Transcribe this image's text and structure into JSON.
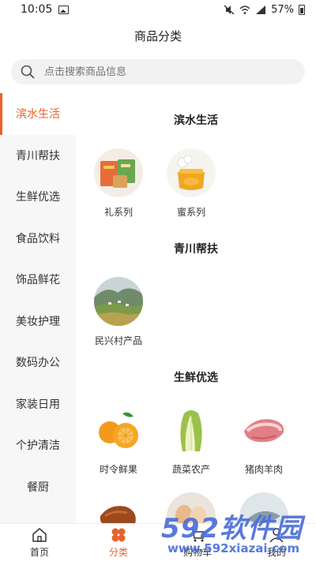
{
  "status_bar": {
    "time": "10:05",
    "battery": "57%"
  },
  "title": "商品分类",
  "search": {
    "placeholder": "点击搜索商品信息"
  },
  "sidebar": {
    "items": [
      {
        "label": "滨水生活"
      },
      {
        "label": "青川帮扶"
      },
      {
        "label": "生鲜优选"
      },
      {
        "label": "食品饮料"
      },
      {
        "label": "饰品鲜花"
      },
      {
        "label": "美妆护理"
      },
      {
        "label": "数码办公"
      },
      {
        "label": "家装日用"
      },
      {
        "label": "个护清洁"
      },
      {
        "label": "餐厨"
      }
    ]
  },
  "sections": [
    {
      "title": "滨水生活",
      "items": [
        {
          "label": "礼系列",
          "icon": "gift-box-image"
        },
        {
          "label": "蜜系列",
          "icon": "honey-jar-image"
        }
      ]
    },
    {
      "title": "青川帮扶",
      "items": [
        {
          "label": "民兴村产品",
          "icon": "village-landscape-image"
        }
      ]
    },
    {
      "title": "生鲜优选",
      "items": [
        {
          "label": "时令鲜果",
          "icon": "oranges-image"
        },
        {
          "label": "蔬菜农产",
          "icon": "cabbage-image"
        },
        {
          "label": "猪肉羊肉",
          "icon": "pork-image"
        }
      ]
    }
  ],
  "bottom_nav": [
    {
      "label": "首页",
      "icon": "home-icon"
    },
    {
      "label": "分类",
      "icon": "category-icon"
    },
    {
      "label": "购物车",
      "icon": "cart-icon"
    },
    {
      "label": "我的",
      "icon": "user-icon"
    }
  ],
  "watermark": {
    "big": "592软件园",
    "small": "www.592xiazai.com"
  },
  "colors": {
    "accent": "#e8622a",
    "sidebar_bg": "#f7f7f7",
    "search_bg": "#f2f2f2",
    "watermark": "#4a6fd8"
  }
}
